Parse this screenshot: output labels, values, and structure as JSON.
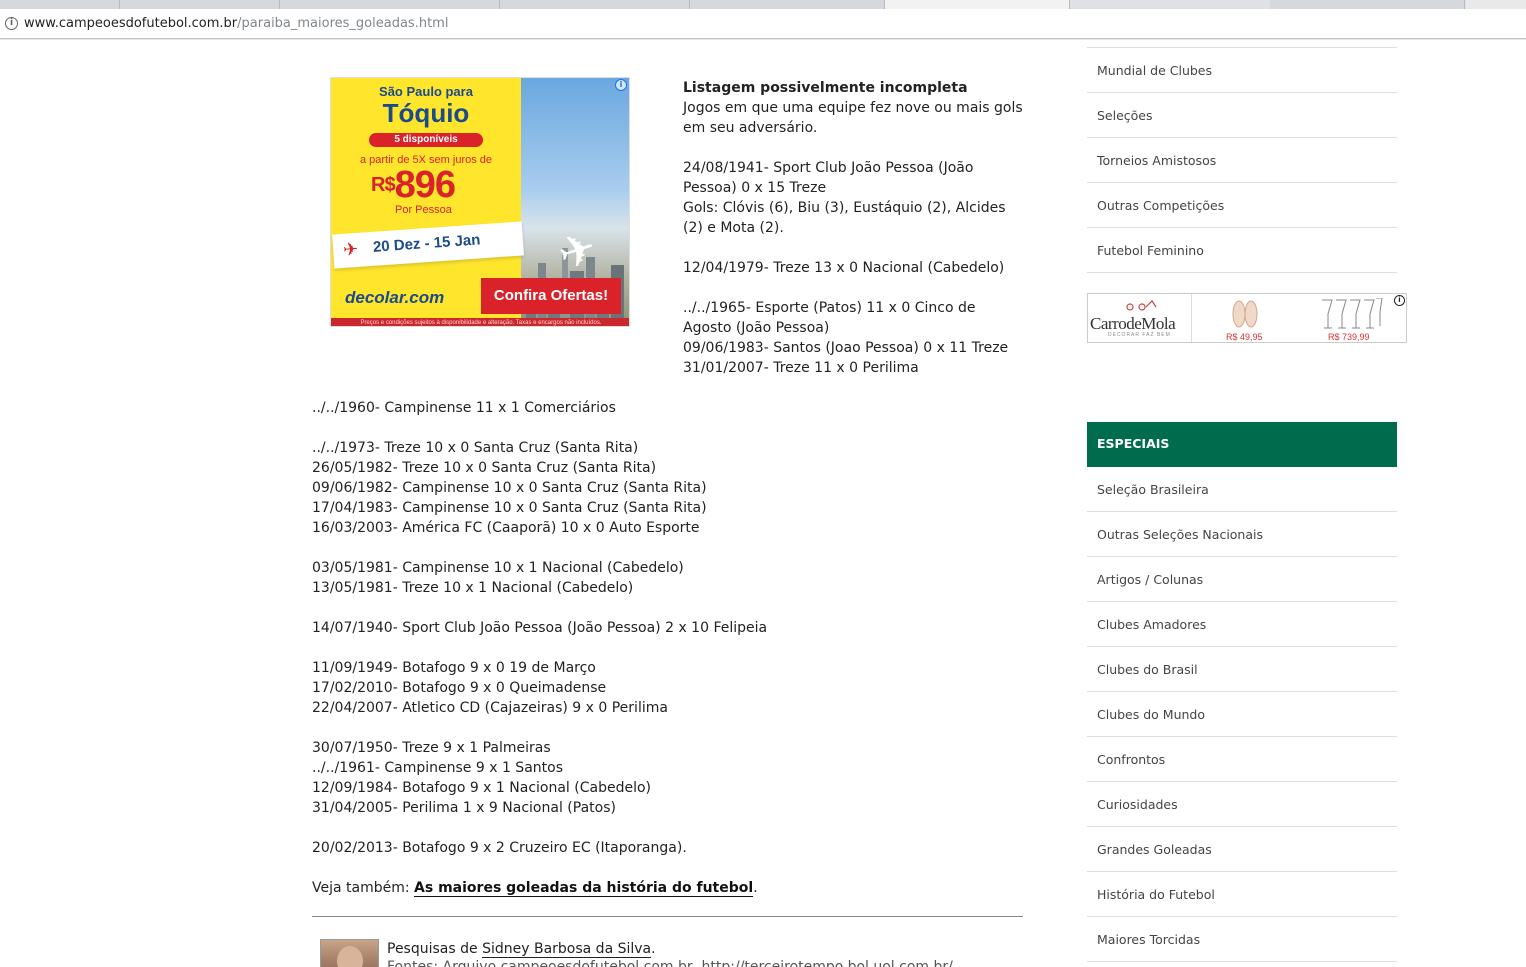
{
  "browser": {
    "url_domain": "www.campeoesdofutebol.com.br",
    "url_path": "/paraiba_maiores_goleadas.html"
  },
  "ad_banner": {
    "line1": "São Paulo para",
    "line2": "Tóquio",
    "badge": "5 disponíveis",
    "line3": "a partir de 5X sem juros de",
    "currency": "R$",
    "price": "896",
    "per_person": "Por Pessoa",
    "dates": "20 Dez - 15 Jan",
    "brand": "decolar.com",
    "cta": "Confira Ofertas!",
    "fine_print": "Preços e condições sujeitos à disponibilidade e alteração. Taxas e encargos não incluídos.",
    "adchoice_icon": "info-icon"
  },
  "intro": {
    "heading": "Listagem possivelmente incompleta",
    "description": "Jogos em que uma equipe fez nove ou mais gols em seu adversário.",
    "match1_line1": "24/08/1941- Sport Club João Pessoa (João Pessoa) 0 x 15 Treze",
    "match1_line2": "Gols: Clóvis (6), Biu (3), Eustáquio (2), Alcides (2) e Mota (2).",
    "match2": "12/04/1979- Treze 13 x 0 Nacional (Cabedelo)",
    "match3": "../../1965- Esporte (Patos) 11 x 0 Cinco de Agosto (João Pessoa)",
    "match4": "09/06/1983- Santos (Joao Pessoa) 0 x 11 Treze",
    "match5": "31/01/2007- Treze 11 x 0 Perilima"
  },
  "results_groups": [
    [
      "../../1960- Campinense 11 x 1 Comerciários"
    ],
    [
      "../../1973- Treze 10 x 0 Santa Cruz (Santa Rita)",
      "26/05/1982- Treze 10 x 0 Santa Cruz (Santa Rita)",
      "09/06/1982- Campinense 10 x 0 Santa Cruz (Santa Rita)",
      "17/04/1983- Campinense 10 x 0 Santa Cruz (Santa Rita)",
      "16/03/2003- América FC (Caaporã) 10 x 0 Auto Esporte"
    ],
    [
      "03/05/1981- Campinense 10 x 1 Nacional (Cabedelo)",
      "13/05/1981- Treze 10 x 1 Nacional (Cabedelo)"
    ],
    [
      "14/07/1940- Sport Club João Pessoa (João Pessoa) 2 x 10 Felipeia"
    ],
    [
      "11/09/1949- Botafogo 9 x 0 19 de Março",
      "17/02/2010- Botafogo 9 x 0 Queimadense",
      "22/04/2007- Atletico CD (Cajazeiras) 9 x 0 Perilima"
    ],
    [
      "30/07/1950- Treze 9 x 1 Palmeiras",
      "../../1961- Campinense 9 x 1 Santos",
      "12/09/1984- Botafogo 9 x 1 Nacional (Cabedelo)",
      "31/04/2005- Perilima 1 x 9 Nacional (Patos)"
    ],
    [
      "20/02/2013- Botafogo 9 x 2 Cruzeiro EC (Itaporanga)."
    ]
  ],
  "see_also": {
    "prefix": "Veja também: ",
    "link": "As maiores goleadas da história do futebol",
    "suffix": "."
  },
  "author": {
    "prefix": "Pesquisas de ",
    "name": "Sidney Barbosa da Silva",
    "suffix": ".",
    "line2": "Fontes: Arquivo campeoesdofutebol.com.br, http://terceirotempo.bol.uol.com.br/"
  },
  "sidebar": {
    "items_top": [
      "Mundial de Clubes",
      "Seleções",
      "Torneios Amistosos",
      "Outras Competições",
      "Futebol Feminino"
    ],
    "ad": {
      "brand": "CarrodeMola",
      "tagline": "DECORAR FAZ BEM",
      "price1": "R$ 49,95",
      "price2": "R$ 739,99"
    },
    "section_header": "ESPECIAIS",
    "items_especiais": [
      "Seleção Brasileira",
      "Outras Seleções Nacionais",
      "Artigos / Colunas",
      "Clubes Amadores",
      "Clubes do Brasil",
      "Clubes do Mundo",
      "Confrontos",
      "Curiosidades",
      "Grandes Goleadas",
      "História do Futebol",
      "Maiores Torcidas"
    ]
  }
}
